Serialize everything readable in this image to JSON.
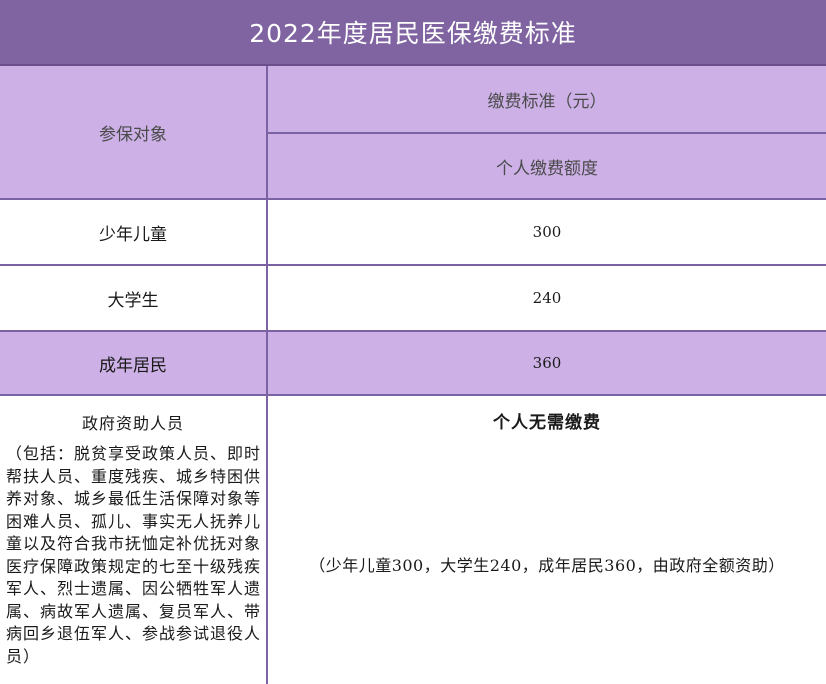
{
  "title": "2022年度居民医保缴费标准",
  "header": {
    "col1": "参保对象",
    "col2_top": "缴费标准（元）",
    "col2_sub": "个人缴费额度"
  },
  "rows": [
    {
      "label": "少年儿童",
      "value": "300"
    },
    {
      "label": "大学生",
      "value": "240"
    },
    {
      "label": "成年居民",
      "value": "360"
    }
  ],
  "gov": {
    "label": "政府资助人员",
    "detail": "（包括：脱贫享受政策人员、即时帮扶人员、重度残疾、城乡特困供养对象、城乡最低生活保障对象等困难人员、孤儿、事实无人抚养儿童以及符合我市抚恤定补优抚对象医疗保障政策规定的七至十级残疾军人、烈士遗属、因公牺牲军人遗属、病故军人遗属、复员军人、带病回乡退伍军人、参战参试退役人员）",
    "no_pay": "个人无需缴费",
    "note": "（少年儿童300，大学生240，成年居民360，由政府全额资助）"
  },
  "colors": {
    "title_bg": "#8064a2",
    "header_bg": "#ccb0e6",
    "border": "#7b62a3"
  }
}
